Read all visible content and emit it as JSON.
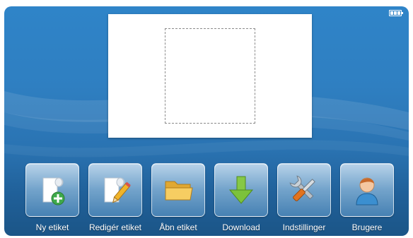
{
  "status": {
    "battery_icon": "battery-full-icon",
    "battery_cells": 3
  },
  "menu": {
    "items": [
      {
        "label": "Ny etiket",
        "icon": "new-label-icon"
      },
      {
        "label": "Redigér etiket",
        "icon": "edit-label-icon"
      },
      {
        "label": "Åbn etiket",
        "icon": "open-folder-icon"
      },
      {
        "label": "Download",
        "icon": "download-arrow-icon"
      },
      {
        "label": "Indstillinger",
        "icon": "tools-icon"
      },
      {
        "label": "Brugere",
        "icon": "user-icon"
      }
    ]
  },
  "colors": {
    "background": "#2f7fc1",
    "tile": "#a8cde9",
    "text": "#ffffff",
    "download_arrow": "#7cc23a",
    "folder": "#f2c14e"
  }
}
